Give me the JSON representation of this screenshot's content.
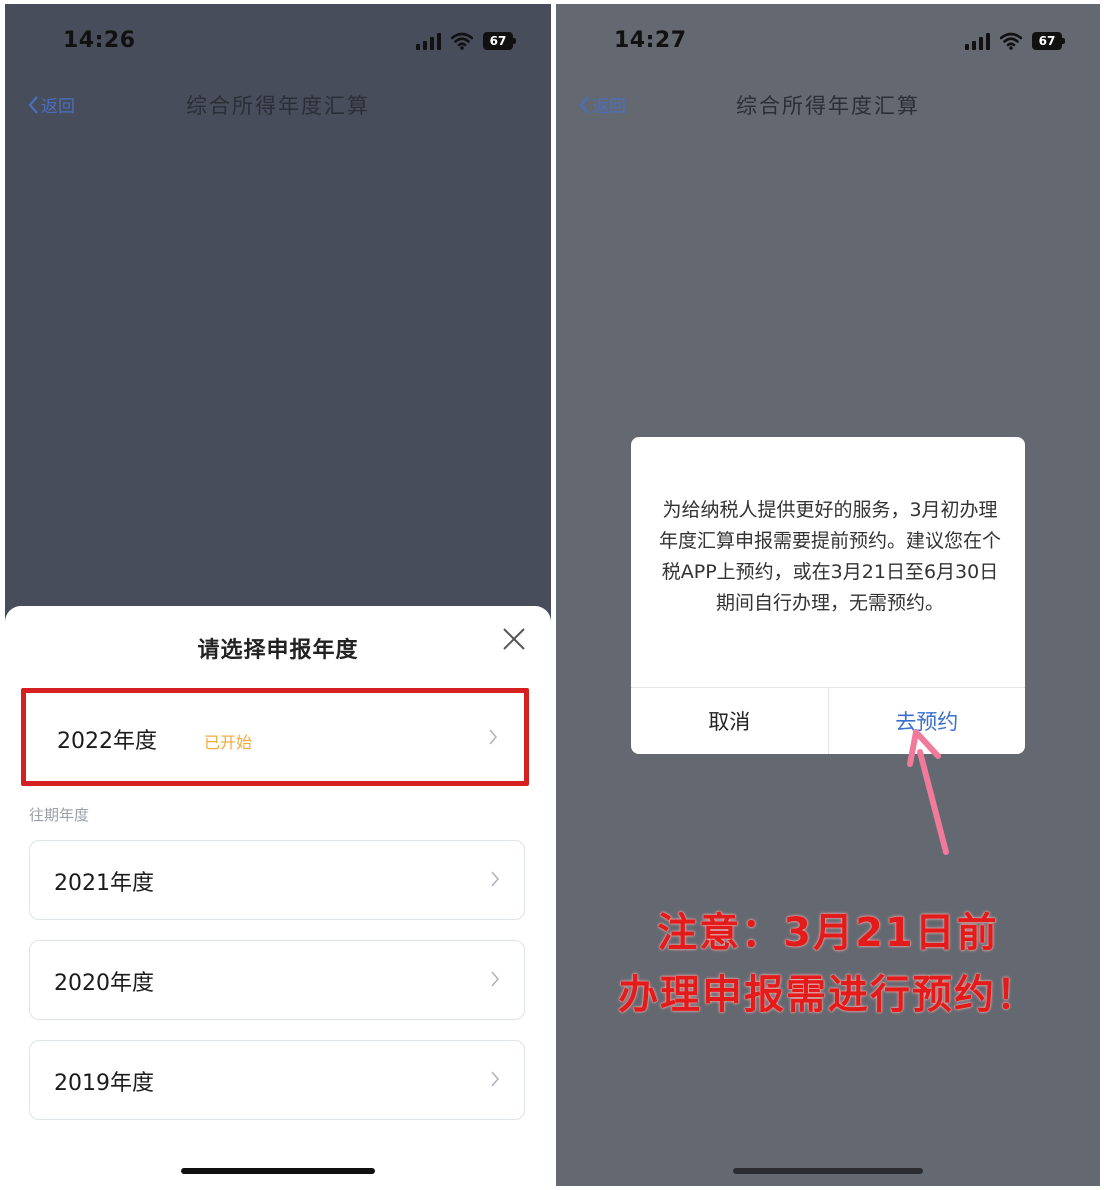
{
  "left": {
    "status": {
      "time": "14:26",
      "battery": "67"
    },
    "nav": {
      "back_label": "返回",
      "title": "综合所得年度汇算"
    },
    "sheet": {
      "title": "请选择申报年度",
      "current": {
        "label": "2022年度",
        "tag": "已开始"
      },
      "past_label": "往期年度",
      "past_years": [
        "2021年度",
        "2020年度",
        "2019年度"
      ]
    }
  },
  "right": {
    "status": {
      "time": "14:27",
      "battery": "67"
    },
    "nav": {
      "back_label": "返回",
      "title": "综合所得年度汇算"
    },
    "dialog": {
      "message": "为给纳税人提供更好的服务，3月初办理年度汇算申报需要提前预约。建议您在个税APP上预约，或在3月21日至6月30日期间自行办理，无需预约。",
      "cancel_label": "取消",
      "confirm_label": "去预约"
    },
    "notice": {
      "line1": "注意：3月21日前",
      "line2": "办理申报需进行预约！"
    }
  },
  "colors": {
    "highlight_border": "#d61f1f",
    "tag_color": "#f2a93b",
    "link_color": "#3c6fcf",
    "notice_color": "#e31b1b",
    "arrow_color": "#f07a9b"
  },
  "icons": [
    "signal-icon",
    "wifi-icon",
    "battery-icon",
    "back-chevron-icon",
    "close-icon",
    "chevron-right-icon",
    "arrow-pointer-icon"
  ]
}
